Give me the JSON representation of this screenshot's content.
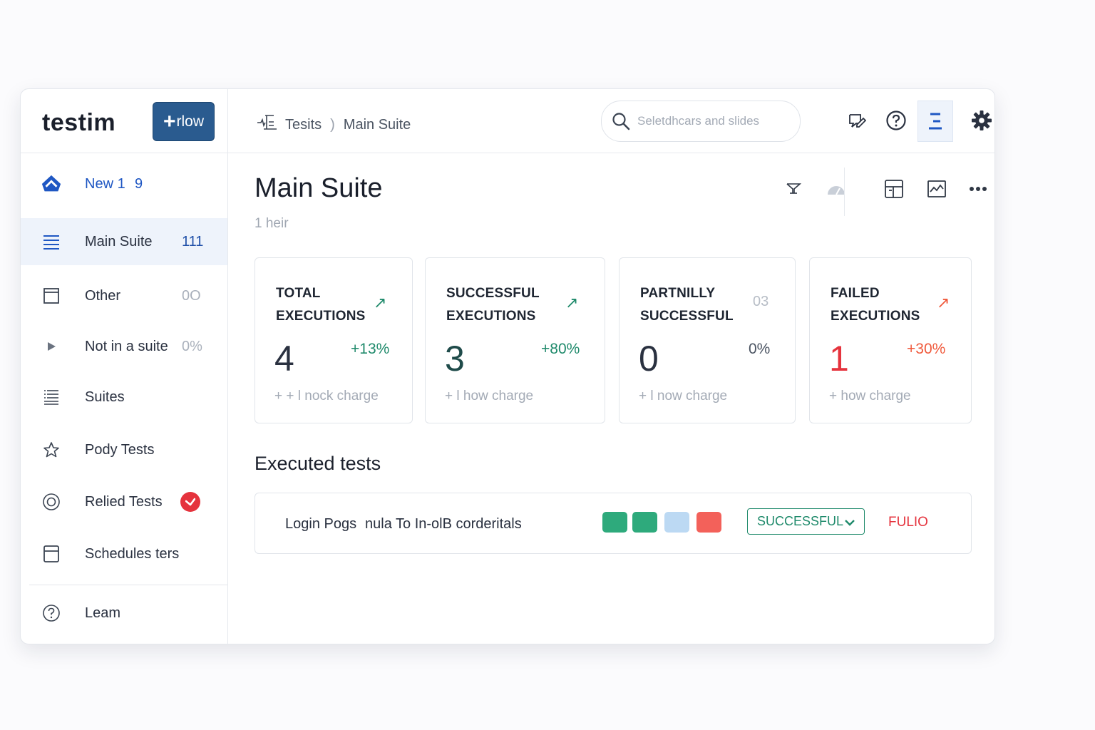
{
  "brand": {
    "logo": "testim",
    "new_button": "rlow",
    "new_plus": "+"
  },
  "sidebar": {
    "items": [
      {
        "label": "New 1",
        "count": "9",
        "icon": "home-icon"
      },
      {
        "label": "Main Suite",
        "count": "111",
        "icon": "list-icon",
        "active": true
      },
      {
        "label": "Other",
        "count": "0O",
        "icon": "window-icon"
      },
      {
        "label": "Not in a suite",
        "count": "0%",
        "icon": "play-icon"
      },
      {
        "label": "Suites",
        "count": "",
        "icon": "stack-icon"
      },
      {
        "label": "Pody Tests",
        "count": "",
        "icon": "star-icon"
      },
      {
        "label": "Relied Tests",
        "count": "",
        "icon": "target-icon",
        "badge": "check-icon"
      },
      {
        "label": "Schedules ters",
        "count": "",
        "icon": "calendar-icon"
      }
    ],
    "footer": {
      "label": "Leam",
      "icon": "help-circle-icon"
    }
  },
  "topbar": {
    "breadcrumb": {
      "root": "Tesits",
      "separator": ")",
      "current": "Main Suite"
    },
    "search": {
      "placeholder": "Seletdhcars and slides",
      "value": ""
    },
    "icons": [
      "chat-edit-icon",
      "help-icon",
      "menu-icon",
      "gear-icon"
    ]
  },
  "page": {
    "title": "Main Suite",
    "subtitle": "1 heir",
    "tools": [
      "filter-icon",
      "gauge-icon",
      "layout-icon",
      "chart-icon",
      "more-icon"
    ]
  },
  "cards": [
    {
      "title": "TOTAL EXECUTIONS",
      "trend": "↗",
      "value": "4",
      "pct": "+13%",
      "note": "+ + l nock charge",
      "color": "#1f8a6b"
    },
    {
      "title": "SUCCESSFUL EXECUTIONS",
      "trend": "↗",
      "value": "3",
      "pct": "+80%",
      "note": "+ l how charge",
      "color": "#1f8a6b"
    },
    {
      "title": "PARTNILLY SUCCESSFUL",
      "trend": "03",
      "value": "0",
      "pct": "0%",
      "note": "+ l now charge",
      "color": "#4b5462"
    },
    {
      "title": "FAILED EXECUTIONS",
      "trend": "↗",
      "value": "1",
      "pct": "+30%",
      "note": "+ how charge",
      "color": "#f05a3c"
    }
  ],
  "executed": {
    "title": "Executed tests",
    "rows": [
      {
        "name": "Login Pogs",
        "description": "nula To In-olB corderitals",
        "chips": [
          "#2eaa7c",
          "#2eaa7c",
          "#bcd9f3",
          "#f3615a"
        ],
        "status": "SUCCESSFUL",
        "result": "FULIO"
      }
    ]
  },
  "colors": {
    "accent": "#2a5b8f",
    "success": "#1f8a6b",
    "danger": "#e5333d",
    "nav_blue": "#1f57c3"
  }
}
